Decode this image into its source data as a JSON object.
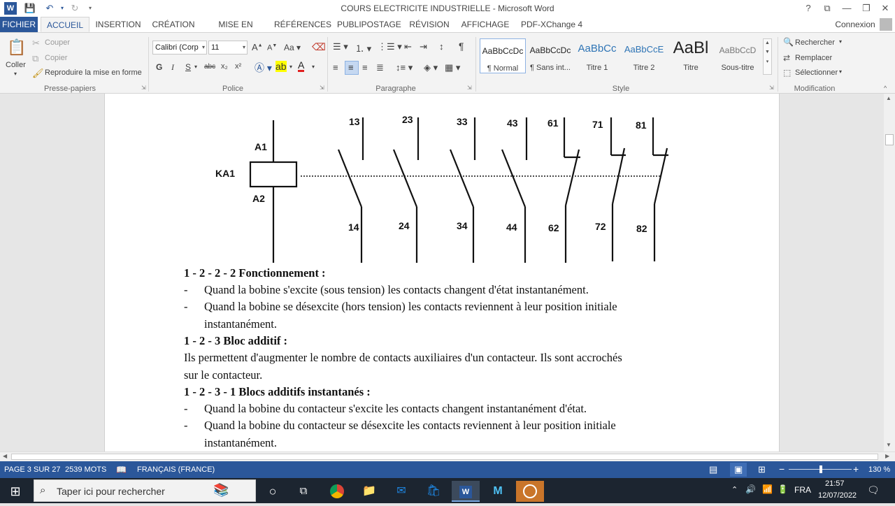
{
  "window": {
    "title": "COURS ELECTRICITE INDUSTRIELLE - Microsoft Word"
  },
  "quick_access": {
    "word_icon": "word-icon",
    "save_icon": "save-icon",
    "undo_icon": "undo-icon",
    "redo_icon": "redo-icon"
  },
  "tabs": [
    "FICHIER",
    "ACCUEIL",
    "INSERTION",
    "CRÉATION",
    "MISE EN PAGE",
    "RÉFÉRENCES",
    "PUBLIPOSTAGE",
    "RÉVISION",
    "AFFICHAGE",
    "PDF-XChange 4"
  ],
  "active_tab": "ACCUEIL",
  "account": "Connexion",
  "clipboard": {
    "paste": "Coller",
    "cut": "Couper",
    "copy": "Copier",
    "format_painter": "Reproduire la mise en forme",
    "label": "Presse-papiers"
  },
  "font": {
    "name": "Calibri (Corp",
    "size": "11",
    "label": "Police",
    "bold": "G",
    "italic": "I",
    "underline": "S",
    "strike": "abc",
    "sub": "x₂",
    "sup": "x²",
    "grow": "A",
    "shrink": "A",
    "case": "Aa"
  },
  "paragraph": {
    "label": "Paragraphe"
  },
  "styles": {
    "label": "Style",
    "items": [
      {
        "sample": "AaBbCcDc",
        "name": "¶ Normal"
      },
      {
        "sample": "AaBbCcDc",
        "name": "¶ Sans int..."
      },
      {
        "sample": "AaBbCc",
        "name": "Titre 1"
      },
      {
        "sample": "AaBbCcE",
        "name": "Titre 2"
      },
      {
        "sample": "AaBl",
        "name": "Titre"
      },
      {
        "sample": "AaBbCcD",
        "name": "Sous-titre"
      }
    ]
  },
  "editing": {
    "find": "Rechercher",
    "replace": "Remplacer",
    "select": "Sélectionner",
    "label": "Modification"
  },
  "diagram": {
    "coil_name": "KA1",
    "coil_top": "A1",
    "coil_bottom": "A2",
    "top_labels": [
      "13",
      "23",
      "33",
      "43",
      "61",
      "71",
      "81"
    ],
    "bottom_labels": [
      "14",
      "24",
      "34",
      "44",
      "62",
      "72",
      "82"
    ]
  },
  "doc": {
    "h_fonctionnement": "1 - 2 - 2 - 2 Fonctionnement :",
    "b1": "Quand la bobine s'excite (sous tension) les contacts changent d'état instantanément.",
    "b2a": "Quand la bobine se désexcite (hors tension) les contacts reviennent à leur position initiale",
    "b2b": "instantanément.",
    "h_bloc": "1 - 2 - 3 Bloc additif :",
    "p1a": "Ils permettent d'augmenter le nombre de contacts auxiliaires d'un contacteur. Ils sont accrochés",
    "p1b": "sur le contacteur.",
    "h_blocs_inst": "1 - 2 - 3 - 1 Blocs additifs instantanés :",
    "b3": "Quand la bobine du contacteur s'excite les contacts changent instantanément d'état.",
    "b4a": "Quand la bobine du contacteur se désexcite les contacts reviennent à leur position initiale",
    "b4b": "instantanément.",
    "dash": "-"
  },
  "status": {
    "page": "PAGE 3 SUR 27",
    "words": "2539 MOTS",
    "language": "FRANÇAIS (FRANCE)",
    "zoom": "130 %"
  },
  "taskbar": {
    "search_placeholder": "Taper ici pour rechercher",
    "lang": "FRA",
    "time": "21:57",
    "date": "12/07/2022"
  },
  "colors": {
    "word_blue": "#2b579a",
    "ribbon_bg": "#f3f3f3",
    "taskbar": "#1c2530"
  }
}
